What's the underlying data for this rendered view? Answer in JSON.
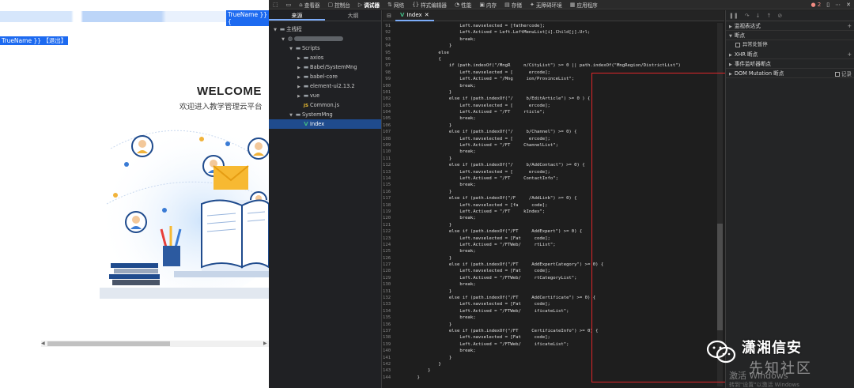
{
  "left_page": {
    "true_name_top": "TrueName }} {",
    "true_name_link": "TrueName }} 【退出】",
    "welcome": "WELCOME",
    "subtitle": "欢迎进入教学管理云平台"
  },
  "toolbar": {
    "items": [
      {
        "icon": "inspect-icon",
        "label": ""
      },
      {
        "icon": "device-icon",
        "label": ""
      },
      {
        "icon": "home-icon",
        "label": "查看器"
      },
      {
        "icon": "console-icon",
        "label": "控制台"
      },
      {
        "icon": "debugger-icon",
        "label": "调试器"
      },
      {
        "icon": "network-icon",
        "label": "网络"
      },
      {
        "icon": "style-editor-icon",
        "label": "样式编辑器"
      },
      {
        "icon": "performance-icon",
        "label": "性能"
      },
      {
        "icon": "memory-icon",
        "label": "内存"
      },
      {
        "icon": "storage-icon",
        "label": "存储"
      },
      {
        "icon": "accessibility-icon",
        "label": "无障碍环境"
      },
      {
        "icon": "application-icon",
        "label": "应用程序"
      }
    ],
    "active_label": "调试器",
    "error_count": "2"
  },
  "navigator": {
    "tabs": [
      "来源",
      "大纲"
    ],
    "tree": [
      {
        "indent": 0,
        "tri": "▼",
        "icon": "folder",
        "label": "主线程"
      },
      {
        "indent": 1,
        "tri": "▼",
        "icon": "globe",
        "label": ""
      },
      {
        "indent": 2,
        "tri": "▼",
        "icon": "folder",
        "label": "Scripts"
      },
      {
        "indent": 3,
        "tri": "▶",
        "icon": "folder",
        "label": "axios"
      },
      {
        "indent": 3,
        "tri": "▶",
        "icon": "folder",
        "label": "Babel/SystemMng"
      },
      {
        "indent": 3,
        "tri": "▶",
        "icon": "folder",
        "label": "babel-core"
      },
      {
        "indent": 3,
        "tri": "▶",
        "icon": "folder",
        "label": "element-ui2.13.2"
      },
      {
        "indent": 3,
        "tri": "▶",
        "icon": "folder",
        "label": "vue"
      },
      {
        "indent": 3,
        "tri": "",
        "icon": "js",
        "label": "Common.js"
      },
      {
        "indent": 2,
        "tri": "▼",
        "icon": "folder",
        "label": "SystemMng"
      },
      {
        "indent": 3,
        "tri": "",
        "icon": "vue",
        "label": "Index",
        "selected": true
      }
    ]
  },
  "editor": {
    "tab_label": "Index",
    "lines": [
      {
        "n": "91",
        "code": "                    Left.navselected = [fathercode];"
      },
      {
        "n": "92",
        "code": "                    Left.Actived = Left.LeftMenuList[i].Child[j].Url;"
      },
      {
        "n": "93",
        "code": "                    break;"
      },
      {
        "n": "94",
        "code": "                }"
      },
      {
        "n": "95",
        "code": "            else"
      },
      {
        "n": "96",
        "code": "            {"
      },
      {
        "n": "97",
        "code": "                if (path.indexOf(\"/MngR     n/CityList\") >= 0 || path.indexOf(\"MngRegion/DistrictList\")"
      },
      {
        "n": "98",
        "code": "                    Left.navselected = [      ercode];"
      },
      {
        "n": "99",
        "code": "                    Left.Actived = \"/Mng     ion/ProvinceList\";"
      },
      {
        "n": "100",
        "code": "                    break;"
      },
      {
        "n": "101",
        "code": "                }"
      },
      {
        "n": "102",
        "code": "                else if (path.indexOf(\"/     b/EditArticle\") >= 0 ) {"
      },
      {
        "n": "103",
        "code": "                    Left.navselected = [      ercode];"
      },
      {
        "n": "104",
        "code": "                    Left.Actived = \"/FT     rticle\";"
      },
      {
        "n": "105",
        "code": "                    break;"
      },
      {
        "n": "106",
        "code": "                }"
      },
      {
        "n": "107",
        "code": "                else if (path.indexOf(\"/     b/Channel\") >= 0) {"
      },
      {
        "n": "108",
        "code": "                    Left.navselected = [      ercode];"
      },
      {
        "n": "109",
        "code": "                    Left.Actived = \"/FT     ChannelList\";"
      },
      {
        "n": "110",
        "code": "                    break;"
      },
      {
        "n": "111",
        "code": "                }"
      },
      {
        "n": "112",
        "code": "                else if (path.indexOf(\"/     b/AddContact\") >= 0) {"
      },
      {
        "n": "113",
        "code": "                    Left.navselected = [      ercode];"
      },
      {
        "n": "114",
        "code": "                    Left.Actived = \"/FT     ContactInfo\";"
      },
      {
        "n": "115",
        "code": "                    break;"
      },
      {
        "n": "116",
        "code": "                }"
      },
      {
        "n": "117",
        "code": "                else if (path.indexOf(\"/F     /AddLink\") >= 0) {"
      },
      {
        "n": "118",
        "code": "                    Left.navselected = [fa     code];"
      },
      {
        "n": "119",
        "code": "                    Left.Actived = \"/FT     kIndex\";"
      },
      {
        "n": "120",
        "code": "                    break;"
      },
      {
        "n": "121",
        "code": "                }"
      },
      {
        "n": "122",
        "code": "                else if (path.indexOf(\"/FT     AddExpert\") >= 0) {"
      },
      {
        "n": "123",
        "code": "                    Left.navselected = [Fat     code];"
      },
      {
        "n": "124",
        "code": "                    Left.Actived = \"/FTWeb/     rtList\";"
      },
      {
        "n": "125",
        "code": "                    break;"
      },
      {
        "n": "126",
        "code": "                }"
      },
      {
        "n": "127",
        "code": "                else if (path.indexOf(\"/FT     AddExpertCategory\") >= 0) {"
      },
      {
        "n": "128",
        "code": "                    Left.navselected = [Fat     code];"
      },
      {
        "n": "129",
        "code": "                    Left.Actived = \"/FTWeb/     rtCategoryList\";"
      },
      {
        "n": "130",
        "code": "                    break;"
      },
      {
        "n": "131",
        "code": "                }"
      },
      {
        "n": "132",
        "code": "                else if (path.indexOf(\"/FT     AddCertificate\") >= 0) {"
      },
      {
        "n": "133",
        "code": "                    Left.navselected = [Fat     code];"
      },
      {
        "n": "134",
        "code": "                    Left.Actived = \"/FTWeb/     ificateList\";"
      },
      {
        "n": "135",
        "code": "                    break;"
      },
      {
        "n": "136",
        "code": "                }"
      },
      {
        "n": "137",
        "code": "                else if (path.indexOf(\"/FT     CertificateInfo\") >= 0) {"
      },
      {
        "n": "138",
        "code": "                    Left.navselected = [Fat     code];"
      },
      {
        "n": "139",
        "code": "                    Left.Actived = \"/FTWeb/     ificateList\";"
      },
      {
        "n": "140",
        "code": "                    break;"
      },
      {
        "n": "141",
        "code": "                }"
      },
      {
        "n": "142",
        "code": "            }"
      },
      {
        "n": "143",
        "code": "        }"
      },
      {
        "n": "144",
        "code": "    }"
      }
    ]
  },
  "right_pane": {
    "watch": "监视表达式",
    "breakpoints": "断点",
    "pause_on_exceptions": "异常处暂停",
    "xhr": "XHR 断点",
    "event_listeners": "事件监听器断点",
    "record": "记录",
    "dom_mutation": "DOM Mutation 断点"
  },
  "watermarks": {
    "windows_line1": "激活 Windows",
    "windows_line2": "转到\"设置\"以激活 Windows",
    "brand": "潇湘信安",
    "brand_sub": "先知社区"
  },
  "colors": {
    "highlight_box": "#e0262a",
    "selection": "#1d6af0",
    "tree_selected": "#1f4b8d"
  }
}
